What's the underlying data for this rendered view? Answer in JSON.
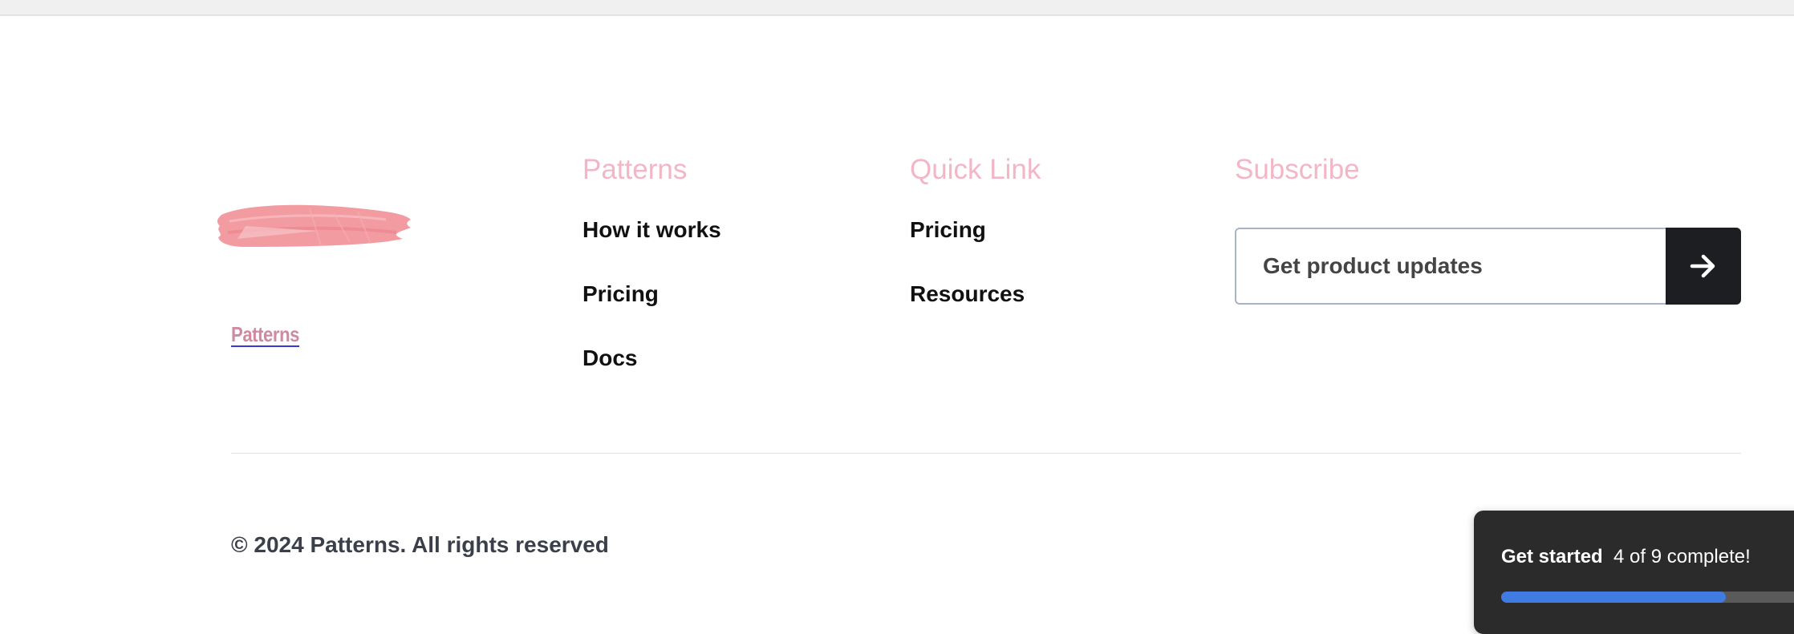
{
  "brand": {
    "link_text": "Patterns",
    "logo_icon": "brush-stroke-logo",
    "logo_color": "#f29ca2"
  },
  "columns": {
    "patterns": {
      "heading": "Patterns",
      "items": [
        "How it works",
        "Pricing",
        "Docs"
      ]
    },
    "quick_link": {
      "heading": "Quick Link",
      "items": [
        "Pricing",
        "Resources"
      ]
    },
    "subscribe": {
      "heading": "Subscribe",
      "placeholder": "Get product updates",
      "button_icon": "arrow-right-icon"
    }
  },
  "copyright": "© 2024 Patterns. All rights reserved",
  "checklist": {
    "title": "Get started",
    "status": "4 of 9 complete!",
    "completed": 4,
    "total": 9,
    "progress_color": "#3f7be0"
  },
  "colors": {
    "heading": "#f3b6c6",
    "link": "#111111",
    "button_bg": "#1c1e21",
    "widget_bg": "#2b2b2b"
  }
}
